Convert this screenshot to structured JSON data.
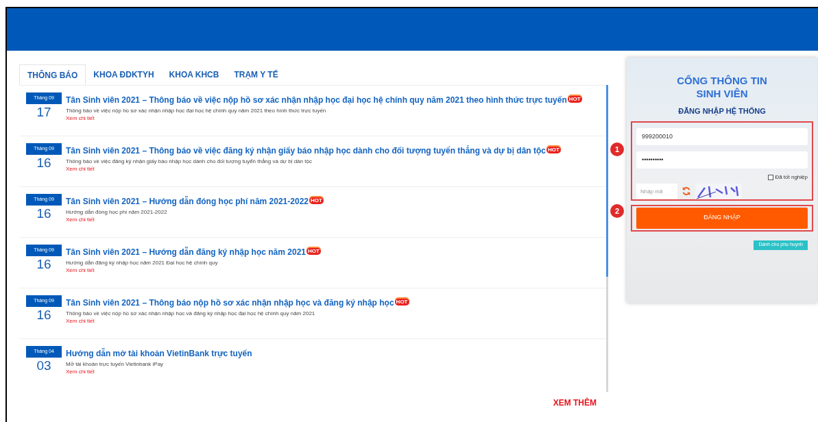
{
  "tabs": [
    {
      "label": "THÔNG BÁO",
      "selected": true
    },
    {
      "label": "KHOA ĐDKTYH",
      "selected": false
    },
    {
      "label": "KHOA KHCB",
      "selected": false
    },
    {
      "label": "TRẠM Y TẾ",
      "selected": false
    }
  ],
  "news": [
    {
      "month": "Tháng 09",
      "day": "17",
      "title": "Tân Sinh viên 2021 – Thông báo về việc nộp hồ sơ xác nhận nhập học đại học hệ chính quy năm 2021 theo hình thức trực tuyến",
      "badge": "HOT",
      "summary": "Thông báo về việc nộp hồ sơ xác nhận nhập học đại học hệ chính quy năm 2021 theo hình thức trực tuyến",
      "link": "Xem chi tiết"
    },
    {
      "month": "Tháng 09",
      "day": "16",
      "title": "Tân Sinh viên 2021 – Thông báo về việc đăng ký nhận giấy báo nhập học dành cho đối tượng tuyển thẳng và dự bị dân tộc",
      "badge": "HOT",
      "summary": "Thông báo về việc đăng ký nhận giấy báo nhập học dành cho đối tượng tuyển thẳng và dự bị dân tộc",
      "link": "Xem chi tiết"
    },
    {
      "month": "Tháng 09",
      "day": "16",
      "title": "Tân Sinh viên 2021 – Hướng dẫn đóng học phí năm 2021-2022",
      "badge": "HOT",
      "summary": "Hướng dẫn đóng học phí năm 2021-2022",
      "link": "Xem chi tiết"
    },
    {
      "month": "Tháng 09",
      "day": "16",
      "title": "Tân Sinh viên 2021 – Hướng dẫn đăng ký nhập học năm 2021",
      "badge": "HOT",
      "summary": "Hướng dẫn đăng ký nhập học năm 2021 Đại học hệ chính quy",
      "link": "Xem chi tiết"
    },
    {
      "month": "Tháng 09",
      "day": "16",
      "title": "Tân Sinh viên 2021 – Thông báo nộp hồ sơ xác nhận nhập học và đăng ký nhập học",
      "badge": "HOT",
      "summary": "Thông báo về việc nộp hồ sơ xác nhận nhập học và đăng ký nhập học đại học hệ chính quy năm 2021",
      "link": "Xem chi tiết"
    },
    {
      "month": "Tháng 04",
      "day": "03",
      "title": "Hướng dẫn mở tài khoản VietinBank trực tuyến",
      "summary": "Mở tài khoản trực tuyến Vietinbank iPay",
      "link": "Xem chi tiết"
    }
  ],
  "more_link": "XEM THÊM",
  "login": {
    "title_lines": [
      "CỔNG THÔNG TIN",
      "SINH VIÊN"
    ],
    "heading": "ĐĂNG NHẬP HỆ THỐNG",
    "username": "999200010",
    "password": "••••••••••",
    "graduated_label": "Đã tốt nghiệp",
    "graduated_checked": false,
    "captcha_placeholder": "Nhập mã",
    "submit": "ĐĂNG NHẬP",
    "parent_button": "Dành cho phụ huynh"
  },
  "step_markers": [
    "1",
    "2"
  ]
}
